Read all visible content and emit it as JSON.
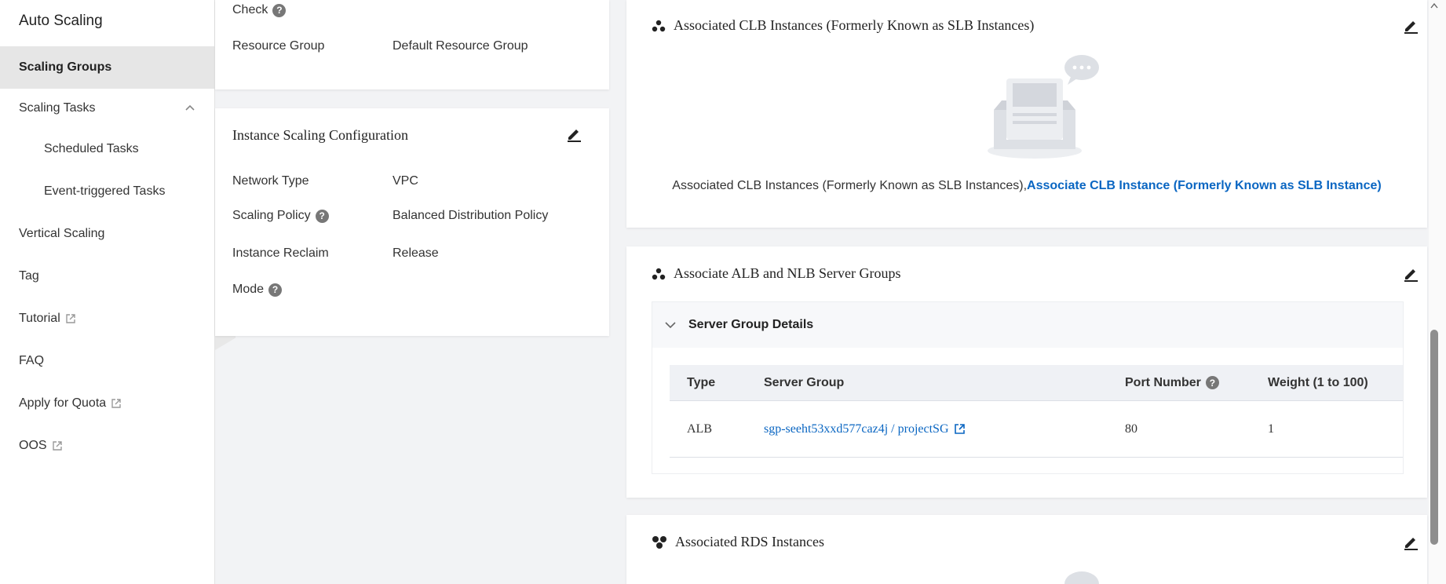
{
  "sidebar": {
    "title": "Auto Scaling",
    "items": [
      {
        "label": "Scaling Groups"
      },
      {
        "label": "Scaling Tasks"
      },
      {
        "label": "Scheduled Tasks"
      },
      {
        "label": "Event-triggered Tasks"
      },
      {
        "label": "Vertical Scaling"
      },
      {
        "label": "Tag"
      },
      {
        "label": "Tutorial"
      },
      {
        "label": "FAQ"
      },
      {
        "label": "Apply for Quota"
      },
      {
        "label": "OOS"
      }
    ]
  },
  "basic_card": {
    "check_label": "Check",
    "resource_group_label": "Resource Group",
    "resource_group_value": "Default Resource Group"
  },
  "instance_config": {
    "title": "Instance Scaling Configuration",
    "network_type_label": "Network Type",
    "network_type_value": "VPC",
    "scaling_policy_label": "Scaling Policy",
    "scaling_policy_value": "Balanced Distribution Policy",
    "reclaim_label": "Instance Reclaim",
    "reclaim_value": "Release",
    "mode_label": "Mode"
  },
  "clb": {
    "title": "Associated CLB Instances (Formerly Known as SLB Instances)",
    "empty_text": "Associated CLB Instances (Formerly Known as SLB Instances),",
    "link_text": "Associate CLB Instance (Formerly Known as SLB Instance)"
  },
  "server_groups": {
    "title": "Associate ALB and NLB Server Groups",
    "section_title": "Server Group Details",
    "columns": [
      "Type",
      "Server Group",
      "Port Number",
      "Weight (1 to 100)"
    ],
    "rows": [
      {
        "type": "ALB",
        "server_group": "sgp-seeht53xxd577caz4j / projectSG",
        "port": "80",
        "weight": "1"
      }
    ]
  },
  "rds": {
    "title": "Associated RDS Instances"
  },
  "colors": {
    "link": "#0a66c2",
    "sidebar_active": "#e6e6e6",
    "page_bg": "#f2f3f5"
  }
}
